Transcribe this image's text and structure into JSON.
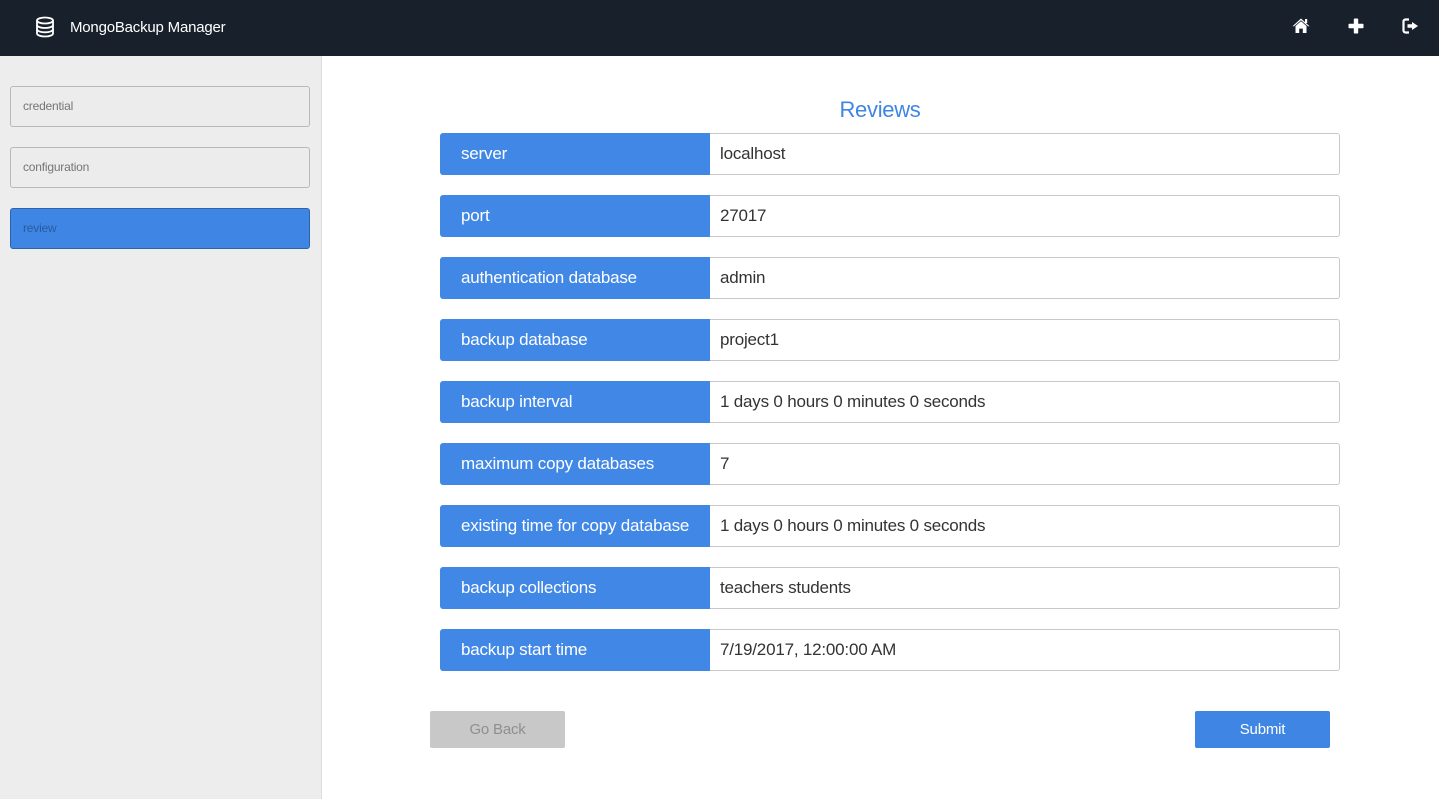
{
  "app": {
    "title": "MongoBackup Manager",
    "brand_icon": "database-icon"
  },
  "header": {
    "icons": [
      {
        "name": "home-icon"
      },
      {
        "name": "plus-icon"
      },
      {
        "name": "sign-out-icon"
      }
    ]
  },
  "sidebar": {
    "items": [
      {
        "label": "credential",
        "active": false
      },
      {
        "label": "configuration",
        "active": false
      },
      {
        "label": "review",
        "active": true
      }
    ]
  },
  "main": {
    "title": "Reviews",
    "rows": [
      {
        "label": "server",
        "value": "localhost"
      },
      {
        "label": "port",
        "value": "27017"
      },
      {
        "label": "authentication database",
        "value": "admin"
      },
      {
        "label": "backup database",
        "value": "project1"
      },
      {
        "label": "backup interval",
        "value": "1 days 0 hours 0 minutes 0 seconds"
      },
      {
        "label": "maximum copy databases",
        "value": "7"
      },
      {
        "label": "existing time for copy database",
        "value": "1 days 0 hours 0 minutes 0 seconds"
      },
      {
        "label": "backup collections",
        "value": "teachers students"
      },
      {
        "label": "backup start time",
        "value": "7/19/2017, 12:00:00 AM"
      }
    ]
  },
  "buttons": {
    "back_label": "Go Back",
    "submit_label": "Submit"
  },
  "colors": {
    "header_bg": "#18202c",
    "accent": "#3f86e4",
    "sidebar_bg": "#ededed"
  }
}
